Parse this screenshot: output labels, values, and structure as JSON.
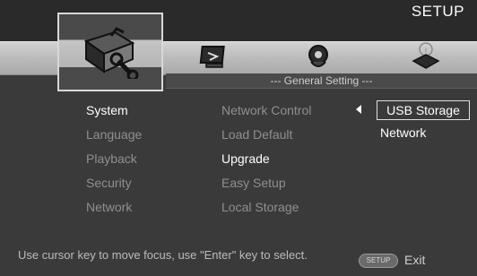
{
  "header": {
    "title": "SETUP"
  },
  "tabs": [
    {
      "name": "system",
      "icon": "toolbox-wrench-icon"
    },
    {
      "name": "display",
      "icon": "display-icon"
    },
    {
      "name": "audio",
      "icon": "speaker-icon"
    },
    {
      "name": "info",
      "icon": "info-icon"
    }
  ],
  "subheader": {
    "label": "--- General Setting ---"
  },
  "categories": [
    {
      "label": "System",
      "active": true
    },
    {
      "label": "Language",
      "active": false
    },
    {
      "label": "Playback",
      "active": false
    },
    {
      "label": "Security",
      "active": false
    },
    {
      "label": "Network",
      "active": false
    }
  ],
  "options": [
    {
      "label": "Network Control",
      "active": false
    },
    {
      "label": "Load Default",
      "active": false
    },
    {
      "label": "Upgrade",
      "active": true
    },
    {
      "label": "Easy Setup",
      "active": false
    },
    {
      "label": "Local Storage",
      "active": false
    }
  ],
  "submenu": {
    "items": [
      "USB Storage",
      "Network"
    ],
    "selected": "USB Storage"
  },
  "footer": {
    "hint": "Use cursor key to move focus, use \"Enter\" key to select.",
    "setup_button_label": "SETUP",
    "exit_label": "Exit"
  },
  "colors": {
    "background": "#3a3a3a",
    "active_text": "#ffffff",
    "inactive_text": "#8f8f8f",
    "strip": "#bdbdbd"
  }
}
